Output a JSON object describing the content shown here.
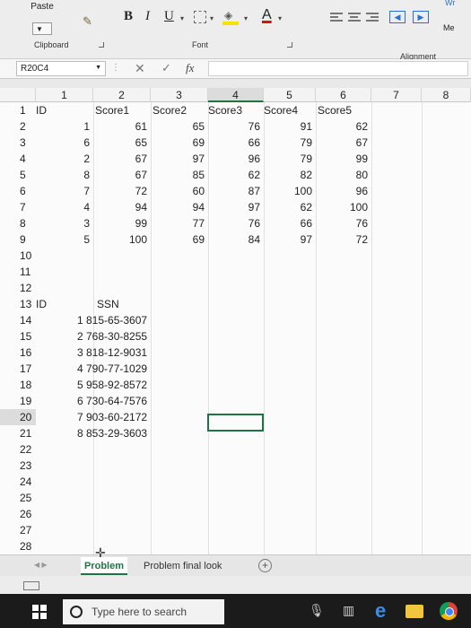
{
  "ribbon": {
    "paste_label": "Paste",
    "bold": "B",
    "italic": "I",
    "underline": "U",
    "font_color_glyph": "A",
    "merge_label": "Me",
    "wrap_label": "Wr",
    "groups": {
      "clipboard": "Clipboard",
      "font": "Font",
      "alignment": "Alignment"
    },
    "colors": {
      "highlight": "#f2e600",
      "font_color": "#d8120a",
      "accent": "#217346"
    }
  },
  "formula_bar": {
    "name_box": "R20C4",
    "fx": "fx",
    "cancel": "✕",
    "enter": "✓",
    "value": ""
  },
  "grid": {
    "columns": [
      "1",
      "2",
      "3",
      "4",
      "5",
      "6",
      "7",
      "8"
    ],
    "rows": [
      "1",
      "2",
      "3",
      "4",
      "5",
      "6",
      "7",
      "8",
      "9",
      "10",
      "11",
      "12",
      "13",
      "14",
      "15",
      "16",
      "17",
      "18",
      "19",
      "20",
      "21",
      "22",
      "23",
      "24",
      "25",
      "26",
      "27",
      "28"
    ],
    "header_row": [
      "ID",
      "Score1",
      "Score2",
      "Score3",
      "Score4",
      "Score5"
    ],
    "scores": [
      [
        "1",
        "61",
        "65",
        "76",
        "91",
        "62"
      ],
      [
        "6",
        "65",
        "69",
        "66",
        "79",
        "67"
      ],
      [
        "2",
        "67",
        "97",
        "96",
        "79",
        "99"
      ],
      [
        "8",
        "67",
        "85",
        "62",
        "82",
        "80"
      ],
      [
        "7",
        "72",
        "60",
        "87",
        "100",
        "96"
      ],
      [
        "4",
        "94",
        "94",
        "97",
        "62",
        "100"
      ],
      [
        "3",
        "99",
        "77",
        "76",
        "66",
        "76"
      ],
      [
        "5",
        "100",
        "69",
        "84",
        "97",
        "72"
      ]
    ],
    "ssn_header": [
      "ID",
      "SSN"
    ],
    "ssn": [
      "1 815-65-3607",
      "2 768-30-8255",
      "3 818-12-9031",
      "4 790-77-1029",
      "5 958-92-8572",
      "6 730-64-7576",
      "7 903-60-2172",
      "8 853-29-3603"
    ]
  },
  "sheets": {
    "tabs": [
      "Problem",
      "Problem final look"
    ],
    "active": "Problem",
    "add": "+"
  },
  "taskbar": {
    "search_placeholder": "Type here to search",
    "edge_glyph": "e"
  }
}
